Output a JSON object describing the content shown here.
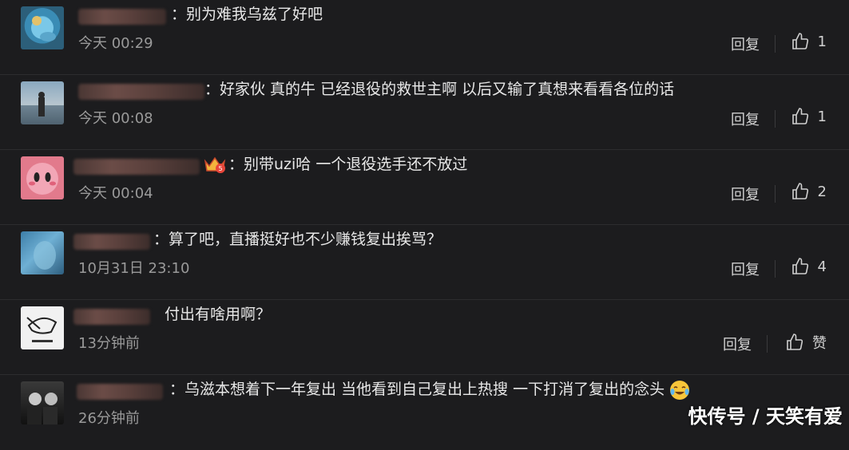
{
  "comments": [
    {
      "text": "：别为难我乌兹了好吧",
      "time": "今天 00:29",
      "reply": "回复",
      "likes": "1"
    },
    {
      "text": "：好家伙 真的牛 已经退役的救世主啊 以后又输了真想来看看各位的话",
      "time": "今天 00:08",
      "reply": "回复",
      "likes": "1"
    },
    {
      "text": "：别带uzi哈 一个退役选手还不放过",
      "time": "今天 00:04",
      "reply": "回复",
      "likes": "2"
    },
    {
      "text": "：算了吧，直播挺好也不少赚钱复出挨骂？",
      "time": "10月31日 23:10",
      "reply": "回复",
      "likes": "4"
    },
    {
      "text": "付出有啥用啊？",
      "time": "13分钟前",
      "reply": "回复",
      "likes": "赞"
    },
    {
      "text": "：乌滋本想着下一年复出 当他看到自己复出上热搜 一下打消了复出的念头",
      "time": "26分钟前",
      "reply": "回复",
      "likes": ""
    }
  ],
  "watermark": "快传号 / 天笑有爱",
  "icons": {
    "like": "thumbs-up-icon",
    "crown": "vip-crown-icon",
    "emoji": "laughing-tears-emoji-icon"
  },
  "colors": {
    "background": "#1c1c1e",
    "text": "#e8e8e8",
    "meta": "#9a9a9a"
  }
}
